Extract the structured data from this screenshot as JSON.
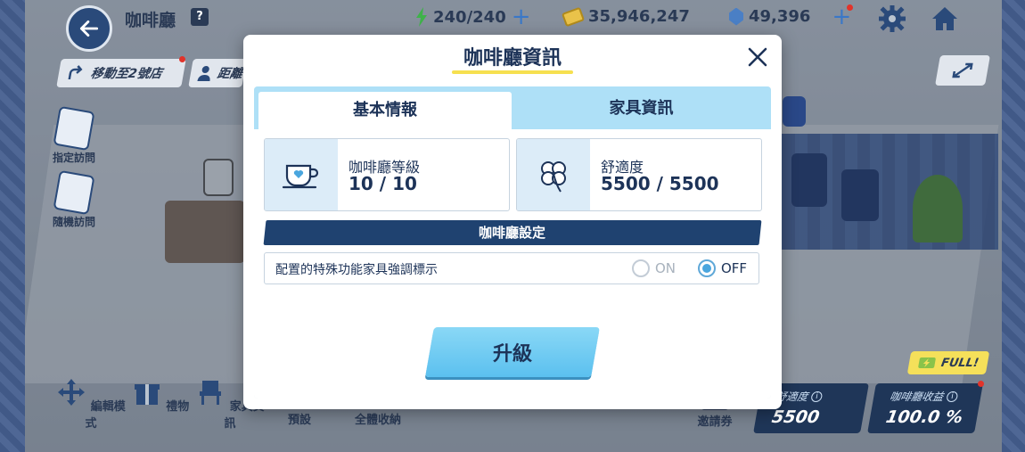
{
  "topbar": {
    "cafe_name": "咖啡廳",
    "help": "?",
    "ap": "240/240",
    "credits": "35,946,247",
    "gems": "49,396"
  },
  "left": {
    "move_label": "移動至2號店",
    "distance_label": "距離",
    "designated_visit": "指定訪問",
    "random_visit": "隨機訪問"
  },
  "modal": {
    "title": "咖啡廳資訊",
    "tabs": [
      {
        "label": "基本情報",
        "active": true
      },
      {
        "label": "家具資訊",
        "active": false
      }
    ],
    "cafe_level": {
      "label": "咖啡廳等級",
      "value": "10 / 10"
    },
    "comfort": {
      "label": "舒適度",
      "value": "5500 / 5500"
    },
    "settings_header": "咖啡廳設定",
    "setting": {
      "label": "配置的特殊功能家具強調標示",
      "on_label": "ON",
      "off_label": "OFF",
      "selected": "OFF"
    },
    "upgrade_label": "升級"
  },
  "bottom": {
    "tools": [
      "編輯模式",
      "禮物",
      "家具資訊",
      "預設",
      "全體收納"
    ],
    "invite": "邀請券",
    "comfort_label": "舒適度",
    "comfort_value": "5500",
    "income_label": "咖啡廳收益",
    "income_value": "100.0 %",
    "full_badge": "FULL!"
  },
  "colors": {
    "navy": "#1d3358",
    "tab_bg": "#aee0f7",
    "accent": "#5bc0ef",
    "title_underline": "#f6e04f",
    "notification": "#e2332a"
  },
  "icons": {
    "back": "arrow-left-icon",
    "ap": "lightning-icon",
    "credits": "coin-icon",
    "gems": "gem-icon",
    "settings": "gear-icon",
    "home": "home-icon",
    "close": "close-icon",
    "cafe_level": "coffee-cup-icon",
    "comfort": "clover-icon"
  }
}
